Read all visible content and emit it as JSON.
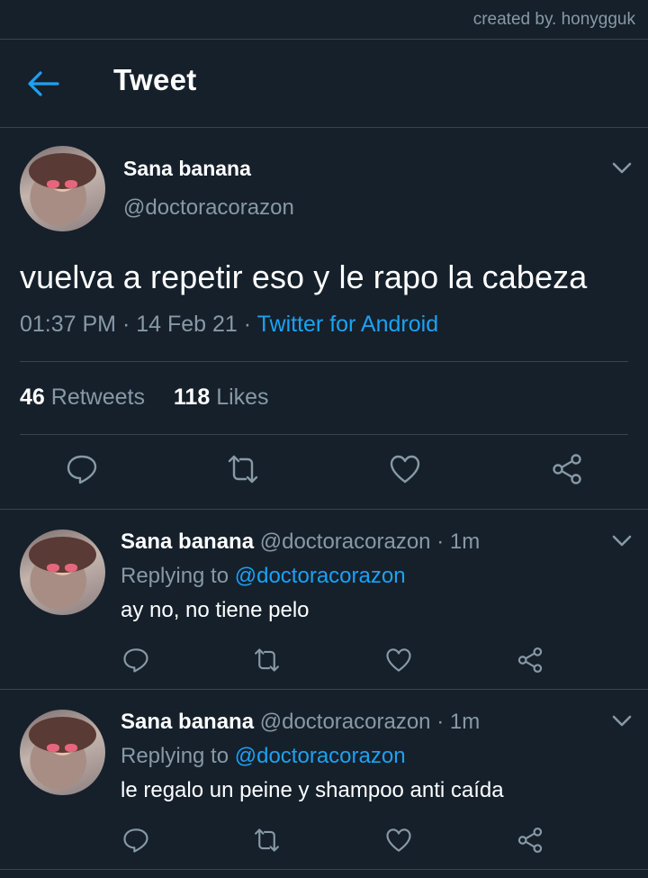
{
  "credit": "created by. honygguk",
  "header": {
    "title": "Tweet"
  },
  "tweet": {
    "name": "Sana banana",
    "handle": "@doctoracorazon",
    "text": "vuelva a repetir eso y le rapo la cabeza",
    "time": "01:37 PM",
    "date": "14 Feb 21",
    "source": "Twitter for Android",
    "retweets": "46",
    "retweets_label": "Retweets",
    "likes": "118",
    "likes_label": "Likes"
  },
  "replies": [
    {
      "name": "Sana banana",
      "handle": "@doctoracorazon",
      "age": "1m",
      "replying_label": "Replying to",
      "replying_to": "@doctoracorazon",
      "text": "ay no, no tiene pelo"
    },
    {
      "name": "Sana banana",
      "handle": "@doctoracorazon",
      "age": "1m",
      "replying_label": "Replying to",
      "replying_to": "@doctoracorazon",
      "text": "le regalo un peine y shampoo anti caída"
    }
  ],
  "icons": {
    "back": "arrow-left-icon",
    "reply": "reply-icon",
    "retweet": "retweet-icon",
    "like": "heart-icon",
    "share": "share-icon",
    "more": "chevron-down-icon"
  },
  "colors": {
    "background": "#15202b",
    "accent": "#1da1f2",
    "muted": "#8899a6",
    "divider": "#38444d"
  }
}
